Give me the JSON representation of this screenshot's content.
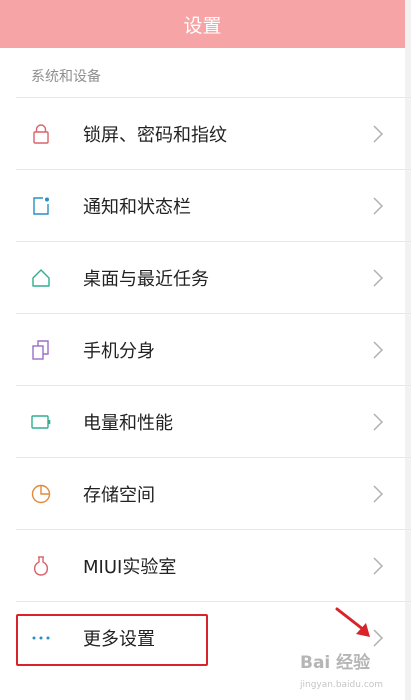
{
  "header": {
    "title": "设置",
    "color": "#f7a4a7"
  },
  "section": {
    "label": "系统和设备"
  },
  "items": [
    {
      "label": "锁屏、密码和指纹",
      "icon": "lock-icon",
      "color": "#d9636a"
    },
    {
      "label": "通知和状态栏",
      "icon": "notification-icon",
      "color": "#2b8ec2"
    },
    {
      "label": "桌面与最近任务",
      "icon": "home-icon",
      "color": "#2fae8f"
    },
    {
      "label": "手机分身",
      "icon": "clone-icon",
      "color": "#9b6fc8"
    },
    {
      "label": "电量和性能",
      "icon": "battery-icon",
      "color": "#2fae8f"
    },
    {
      "label": "存储空间",
      "icon": "storage-pie-icon",
      "color": "#e28a3c"
    },
    {
      "label": "MIUI实验室",
      "icon": "flask-icon",
      "color": "#d9636a"
    },
    {
      "label": "更多设置",
      "icon": "more-dots-icon",
      "color": "#2b8ec2"
    }
  ],
  "annotation": {
    "highlight_color": "#d9232a"
  },
  "watermark": {
    "text": "Bai 经验",
    "sub": "jingyan.baidu.com"
  }
}
